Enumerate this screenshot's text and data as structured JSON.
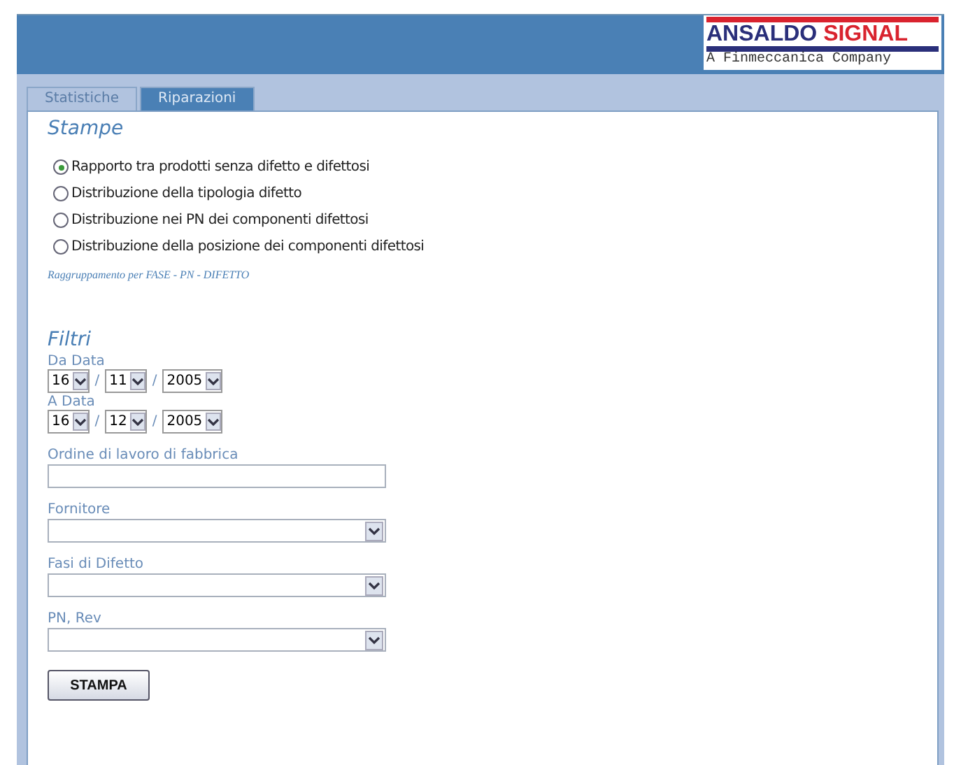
{
  "logo": {
    "name_left": "ANSALDO",
    "name_right": "SIGNAL",
    "tagline": "A Finmeccanica Company"
  },
  "tabs": [
    {
      "label": "Statistiche",
      "selected": false
    },
    {
      "label": "Riparazioni",
      "selected": true
    }
  ],
  "stampe": {
    "title": "Stampe",
    "options": [
      {
        "label": "Rapporto tra prodotti senza difetto e difettosi",
        "selected": true
      },
      {
        "label": "Distribuzione della tipologia difetto",
        "selected": false
      },
      {
        "label": "Distribuzione nei PN dei componenti difettosi",
        "selected": false
      },
      {
        "label": "Distribuzione della posizione dei componenti difettosi",
        "selected": false
      }
    ],
    "note": "Raggruppamento per FASE - PN - DIFETTO"
  },
  "filtri": {
    "title": "Filtri",
    "dates": [
      {
        "label": "Da Data",
        "day": "16",
        "month": "11",
        "year": "2005",
        "separator": "/"
      },
      {
        "label": "A Data",
        "day": "16",
        "month": "12",
        "year": "2005",
        "separator": "/"
      }
    ],
    "fields": [
      {
        "kind": "text",
        "label": "Ordine di lavoro di fabbrica"
      },
      {
        "kind": "select",
        "label": "Fornitore"
      },
      {
        "kind": "select",
        "label": "Fasi di Difetto"
      },
      {
        "kind": "select",
        "label": "PN, Rev"
      }
    ]
  },
  "button": "STAMPA"
}
